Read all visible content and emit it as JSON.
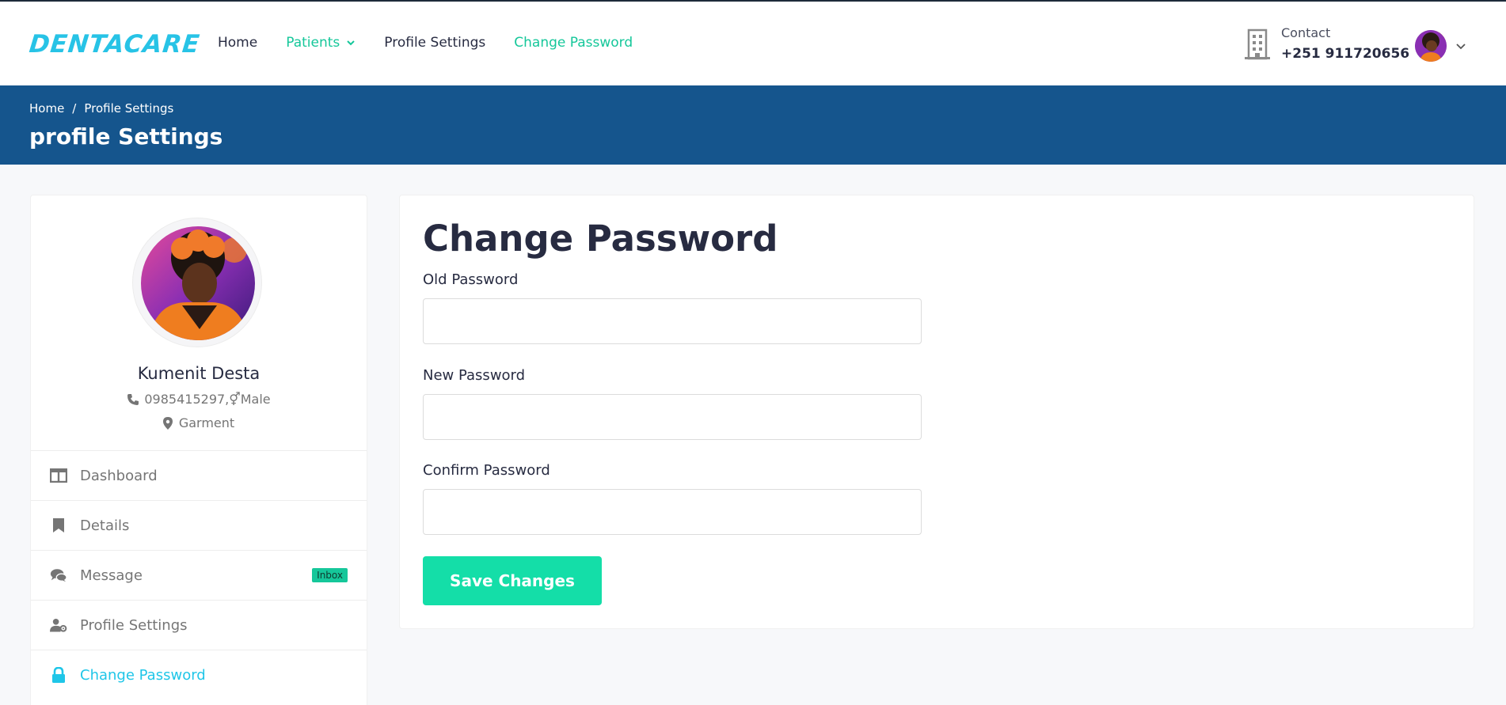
{
  "brand": {
    "logo_text": "DENTACARE",
    "accent": "#27c3e6"
  },
  "nav": {
    "items": [
      {
        "label": "Home",
        "color": "#272b41"
      },
      {
        "label": "Patients",
        "color": "#15c79a",
        "has_dropdown": true
      },
      {
        "label": "Profile Settings",
        "color": "#272b41"
      },
      {
        "label": "Change Password",
        "color": "#15c79a"
      }
    ]
  },
  "contact": {
    "label": "Contact",
    "phone": "+251 911720656",
    "icon": "building-icon"
  },
  "header_user": {
    "avatar_icon": "user-avatar",
    "menu_icon": "chevron-down-icon"
  },
  "breadcrumb": {
    "items": [
      "Home",
      "/",
      "Profile Settings"
    ],
    "title": "profile Settings",
    "bg_color": "#15558d"
  },
  "profile": {
    "name": "Kumenit Desta",
    "phone_gender": "0985415297,⚥Male",
    "location": "Garment"
  },
  "sidebar_menu": [
    {
      "label": "Dashboard",
      "icon": "columns-icon"
    },
    {
      "label": "Details",
      "icon": "bookmark-icon"
    },
    {
      "label": "Message",
      "icon": "comments-icon",
      "badge": "Inbox"
    },
    {
      "label": "Profile Settings",
      "icon": "user-cog-icon"
    },
    {
      "label": "Change Password",
      "icon": "lock-icon",
      "active": true
    }
  ],
  "form": {
    "title": "Change Password",
    "fields": [
      {
        "label": "Old Password",
        "value": "",
        "placeholder": ""
      },
      {
        "label": "New Password",
        "value": "",
        "placeholder": ""
      },
      {
        "label": "Confirm Password",
        "value": "",
        "placeholder": ""
      }
    ],
    "submit_label": "Save Changes",
    "submit_color": "#14dea8"
  }
}
